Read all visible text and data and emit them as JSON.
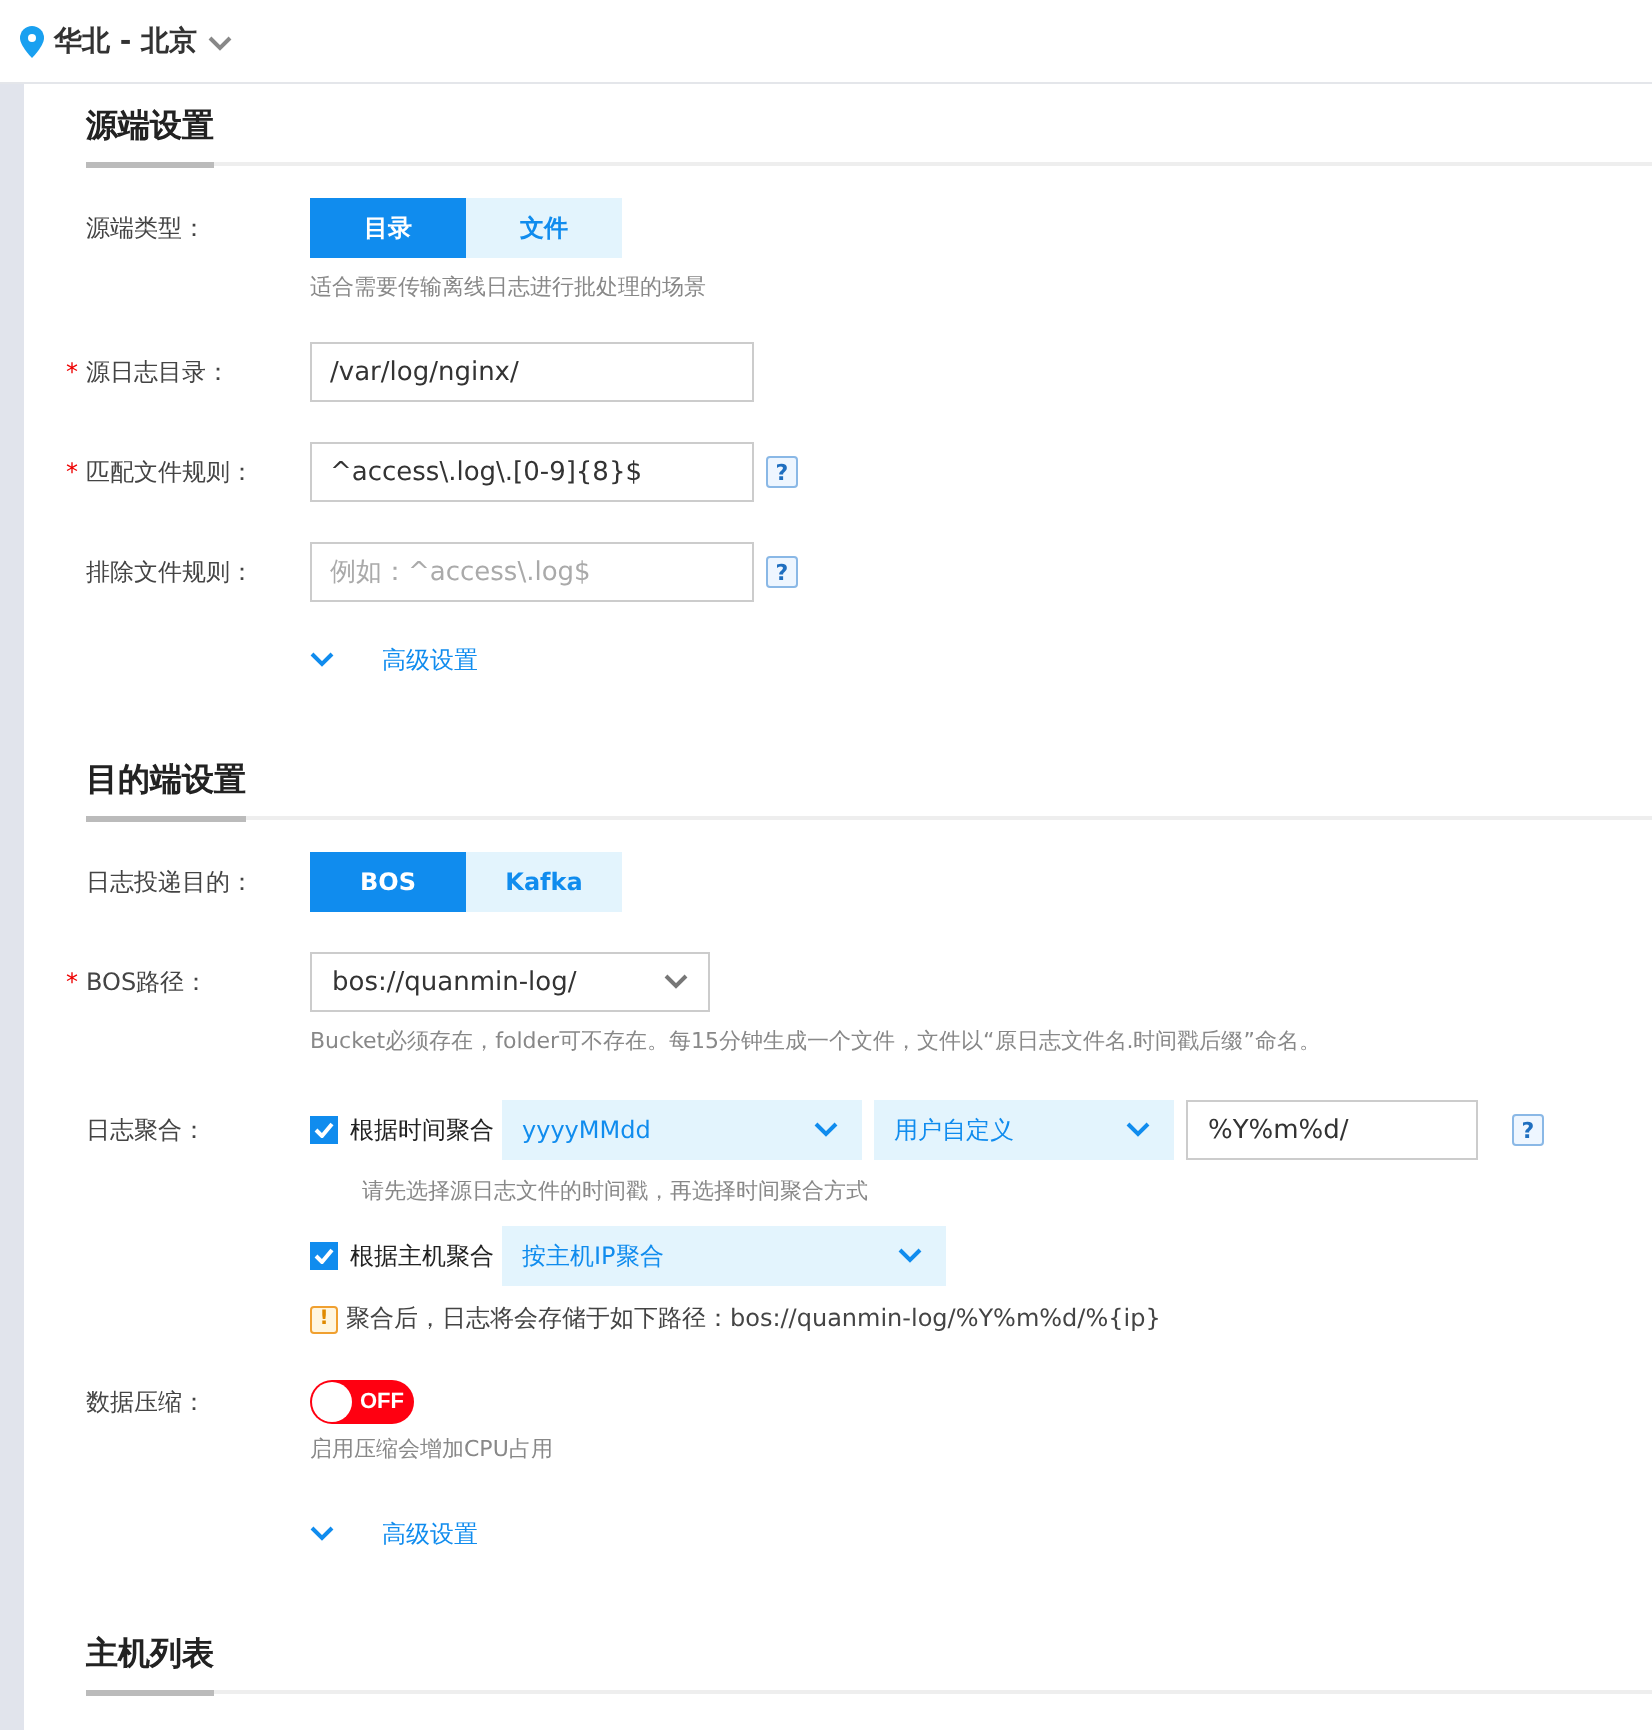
{
  "region": {
    "label": "华北 - 北京"
  },
  "source": {
    "title": "源端设置",
    "type_row": {
      "label": "源端类型：",
      "options": [
        {
          "label": "目录",
          "selected": true
        },
        {
          "label": "文件",
          "selected": false
        }
      ],
      "hint": "适合需要传输离线日志进行批处理的场景"
    },
    "fields": [
      {
        "label": "源日志目录：",
        "required_mark": "*",
        "value": "/var/log/nginx/"
      },
      {
        "label": "匹配文件规则：",
        "required_mark": "*",
        "value": "^access\\.log\\.[0-9]{8}$",
        "help": "?"
      },
      {
        "label": "排除文件规则：",
        "placeholder": "例如：^access\\.log$",
        "help": "?"
      }
    ],
    "advanced": {
      "label": "高级设置"
    }
  },
  "destination": {
    "title": "目的端设置",
    "target_row": {
      "label": "日志投递目的：",
      "options": [
        {
          "label": "BOS",
          "selected": true
        },
        {
          "label": "Kafka",
          "selected": false
        }
      ]
    },
    "bos_path": {
      "label": "BOS路径：",
      "required_mark": "*",
      "value": "bos://quanmin-log/",
      "hint": "Bucket必须存在，folder可不存在。每15分钟生成一个文件，文件以“原日志文件名.时间戳后缀”命名。"
    },
    "aggregation": {
      "label": "日志聚合：",
      "time": {
        "checked": true,
        "label": "根据时间聚合",
        "format": "yyyyMMdd",
        "mode": "用户自定义",
        "custom": "%Y%m%d/",
        "help": "?",
        "hint": "请先选择源日志文件的时间戳，再选择时间聚合方式"
      },
      "host": {
        "checked": true,
        "label": "根据主机聚合",
        "mode": "按主机IP聚合"
      },
      "notice": {
        "mark": "!",
        "text": "聚合后，日志将会存储于如下路径：bos://quanmin-log/%Y%m%d/%{ip}"
      }
    },
    "compression": {
      "label": "数据压缩：",
      "on": false,
      "state_text": "OFF",
      "hint": "启用压缩会增加CPU占用"
    },
    "advanced": {
      "label": "高级设置"
    }
  },
  "hosts": {
    "title": "主机列表"
  }
}
